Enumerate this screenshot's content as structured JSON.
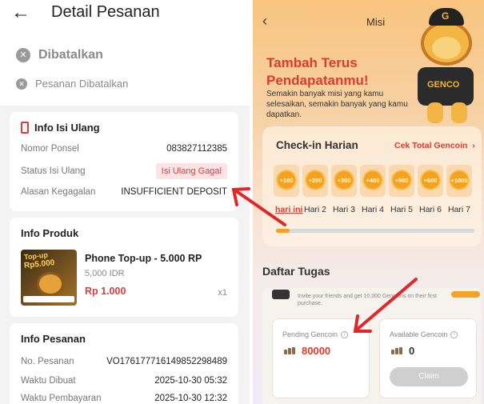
{
  "left": {
    "title": "Detail Pesanan",
    "status": "Dibatalkan",
    "status_sub": "Pesanan Dibatalkan",
    "topup_card": {
      "heading": "Info Isi Ulang",
      "rows": [
        {
          "key": "Nomor Ponsel",
          "value": "083827112385"
        },
        {
          "key": "Status Isi Ulang",
          "value": "Isi Ulang Gagal"
        },
        {
          "key": "Alasan Kegagalan",
          "value": "INSUFFICIENT DEPOSIT"
        }
      ]
    },
    "product_card": {
      "heading": "Info Produk",
      "image_title": "Top-up",
      "image_price": "Rp5.000",
      "name": "Phone Top-up - 5.000 RP",
      "sub": "5,000 IDR",
      "price": "Rp 1.000",
      "qty": "x1"
    },
    "order_card": {
      "heading": "Info Pesanan",
      "rows": [
        {
          "key": "No. Pesanan",
          "value": "VO176177716149852298489"
        },
        {
          "key": "Waktu Dibuat",
          "value": "2025-10-30 05:32"
        },
        {
          "key": "Waktu Pembayaran",
          "value": "2025-10-30 12:32"
        }
      ]
    }
  },
  "right": {
    "title": "Misi",
    "banner": {
      "title_line1": "Tambah Terus",
      "title_line2": "Pendapatanmu!",
      "subtitle": "Semakin banyak misi yang kamu selesaikan, semakin banyak yang kamu dapatkan.",
      "mascot_cap": "G",
      "mascot_shirt": "GENCO"
    },
    "checkin": {
      "title": "Check-in Harian",
      "link": "Cek Total Gencoin",
      "rewards": [
        "+100",
        "+200",
        "+300",
        "+400",
        "+500",
        "+600",
        "+1000"
      ],
      "days": [
        "hari ini",
        "Hari 2",
        "Hari 3",
        "Hari 4",
        "Hari 5",
        "Hari 6",
        "Hari 7"
      ],
      "progress": 0.07
    },
    "tasks": {
      "title": "Daftar Tugas",
      "partial_task_text": "Invite your friends and get 10,000 Gencoins on their first purchase.",
      "pending_label": "Pending Gencoin",
      "pending_value": "80000",
      "available_label": "Available Gencoin",
      "available_value": "0",
      "claim_label": "Claim"
    }
  },
  "colors": {
    "accent_red": "#e2392d",
    "coin_orange": "#f3a223",
    "annotation_arrow": "#e3262a"
  }
}
